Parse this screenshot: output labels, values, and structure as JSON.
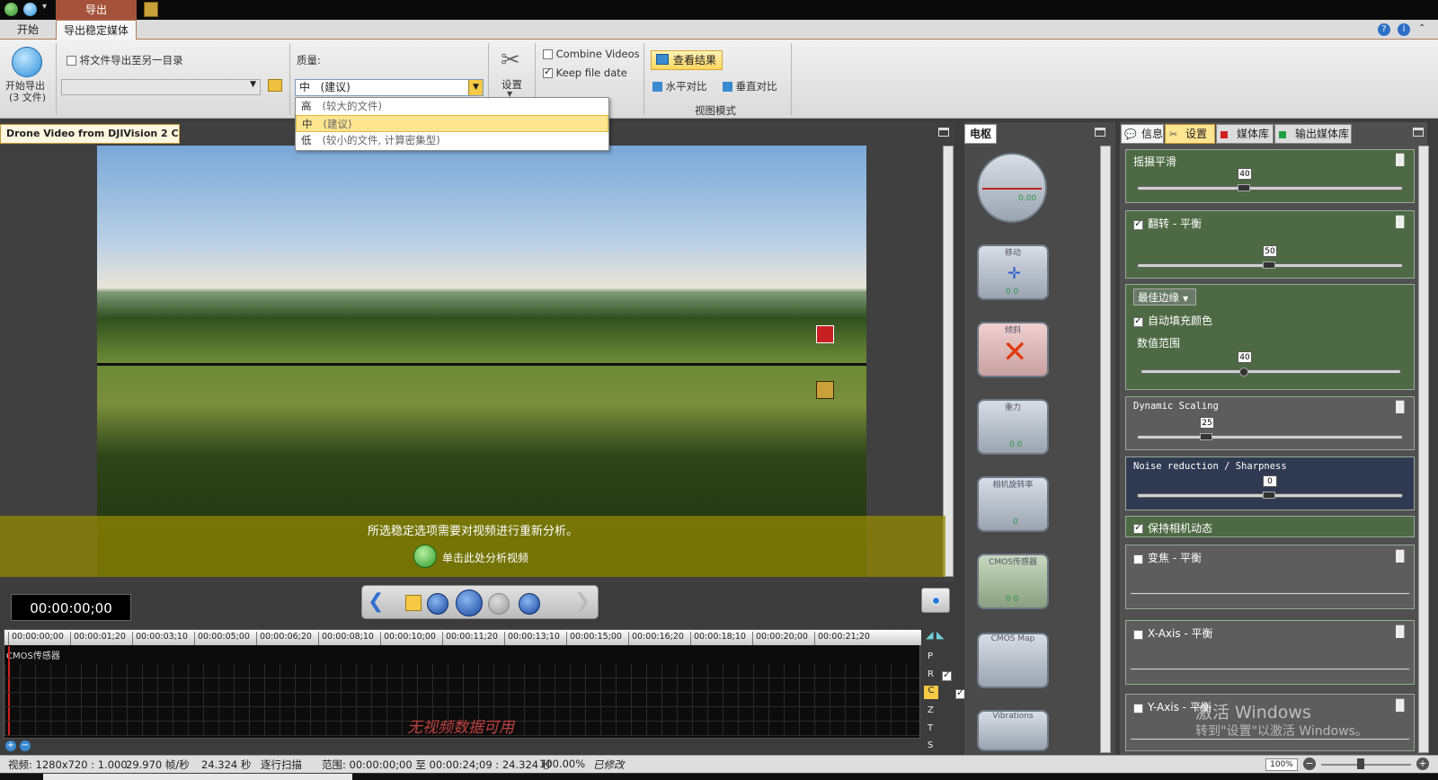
{
  "app": {
    "top_tab": "导出",
    "ribbon_tabs": [
      "开始",
      "导出稳定媒体"
    ]
  },
  "ribbon": {
    "start_export_label_line1": "开始导出",
    "start_export_label_line2": "(3 文件)",
    "export_other_dir_label": "将文件导出至另一目录",
    "path_value": "",
    "quality_label": "质量:",
    "quality_selected_main": "中",
    "quality_selected_sub": "(建议)",
    "quality_options": [
      {
        "main": "高",
        "sub": "(较大的文件)"
      },
      {
        "main": "中",
        "sub": "(建议)"
      },
      {
        "main": "低",
        "sub": "(较小的文件, 计算密集型)"
      }
    ],
    "settings_label": "设置",
    "combine_videos_label": "Combine Videos",
    "combine_videos_checked": false,
    "keep_file_date_label": "Keep file date",
    "keep_file_date_checked": true,
    "view_results_label": "查看结果",
    "horizontal_compare_label": "水平对比",
    "vertical_compare_label": "垂直对比",
    "view_mode_label": "视图模式"
  },
  "video": {
    "tab_title": "Drone Video from DJIVision 2 C...",
    "overlay_message": "所选稳定选项需要对视频进行重新分析。",
    "overlay_action": "单击此处分析视频",
    "timecode": "00:00:00;00",
    "timeline_ticks": [
      "00:00:00;00",
      "00:00:01;20",
      "00:00:03;10",
      "00:00:05;00",
      "00:00:06;20",
      "00:00:08;10",
      "00:00:10;00",
      "00:00:11;20",
      "00:00:13;10",
      "00:00:15;00",
      "00:00:16;20",
      "00:00:18;10",
      "00:00:20;00",
      "00:00:21;20"
    ],
    "track_label": "CMOS传感器",
    "no_data_text": "无视频数据可用",
    "side_letters": [
      "P",
      "R",
      "C",
      "Z",
      "T",
      "S"
    ]
  },
  "center_panel": {
    "tab_label": "电枢",
    "gauges": [
      {
        "label": "",
        "value": "0.00"
      },
      {
        "label": "移动",
        "value": "0   0"
      },
      {
        "label": "倾斜",
        "value": ""
      },
      {
        "label": "重力",
        "value": "0.0"
      },
      {
        "label": "相机旋转率",
        "value": "0"
      },
      {
        "label": "CMOS传感器",
        "value": "0   0"
      },
      {
        "label": "CMOS Map",
        "value": ""
      },
      {
        "label": "Vibrations",
        "value": ""
      }
    ]
  },
  "right_panel": {
    "tabs": [
      "信息",
      "设置",
      "媒体库",
      "输出媒体库"
    ],
    "groups": {
      "shake_smooth": {
        "label": "摇摄平滑",
        "value": 40
      },
      "flip_balance": {
        "label": "翻转 - 平衡",
        "value": 50,
        "checked": true
      },
      "best_edge": {
        "dropdown": "最佳边缘",
        "auto_fill_label": "自动填充颜色",
        "auto_fill_checked": true,
        "range_label": "数值范围",
        "value": 40
      },
      "dynamic_scaling": {
        "label": "Dynamic Scaling",
        "value": 25
      },
      "noise_reduction": {
        "label": "Noise reduction / Sharpness",
        "value": 0
      },
      "keep_camera": {
        "label": "保持相机动态",
        "checked": true
      },
      "zoom_balance": {
        "label": "变焦 - 平衡",
        "checked": false
      },
      "x_axis": {
        "label": "X-Axis - 平衡",
        "checked": false
      },
      "y_axis": {
        "label": "Y-Axis - 平衡",
        "checked": false
      }
    },
    "watermark_line1": "激活 Windows",
    "watermark_line2": "转到\"设置\"以激活 Windows。"
  },
  "status": {
    "video": "视频: 1280x720 : 1.000",
    "fps": "29.970 帧/秒",
    "duration": "24.324 秒",
    "scan": "逐行扫描",
    "range": "范围: 00:00:00;00 至 00:00:24;09 : 24.324 秒",
    "percent": "100.00%",
    "modified": "已修改",
    "zoom": "100%"
  }
}
